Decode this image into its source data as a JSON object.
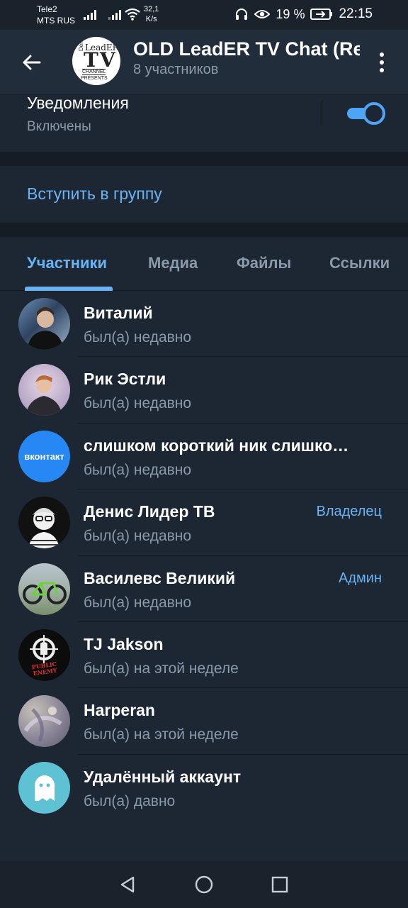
{
  "status_bar": {
    "carrier1": "Tele2",
    "carrier2": "MTS RUS",
    "speed_value": "32,1",
    "speed_unit": "K/s",
    "battery": "19 %",
    "time": "22:15"
  },
  "header": {
    "title": "OLD LeadER TV Chat (Re",
    "subtitle": "8 участников",
    "avatar_text": {
      "name": "LeadER",
      "tv": "TV",
      "channel": "CHANNEL",
      "presents": "PRESENTS",
      "denis": "Denis"
    }
  },
  "notifications": {
    "title": "Уведомления",
    "status": "Включены",
    "enabled": true
  },
  "join_button": "Вступить в группу",
  "tabs": [
    {
      "label": "Участники",
      "active": true
    },
    {
      "label": "Медиа",
      "active": false
    },
    {
      "label": "Файлы",
      "active": false
    },
    {
      "label": "Ссылки",
      "active": false
    }
  ],
  "members": [
    {
      "name": "Виталий",
      "status": "был(а) недавно",
      "role": ""
    },
    {
      "name": "Рик Эстли",
      "status": "был(а) недавно",
      "role": ""
    },
    {
      "name": "слишком короткий ник слишко…",
      "status": "был(а) недавно",
      "role": "",
      "avatar_text": "вконтакт"
    },
    {
      "name": "Денис Лидер ТВ",
      "status": "был(а) недавно",
      "role": "Владелец"
    },
    {
      "name": "Василевс Великий",
      "status": "был(а) недавно",
      "role": "Админ"
    },
    {
      "name": "TJ Jakson",
      "status": "был(а) на этой неделе",
      "role": "",
      "avatar_text": "PUBLIC ENEMY"
    },
    {
      "name": "Harperan",
      "status": "был(а) на этой неделе",
      "role": ""
    },
    {
      "name": "Удалённый аккаунт",
      "status": "был(а) давно",
      "role": ""
    }
  ],
  "colors": {
    "background": "#1d2733",
    "header": "#212d3b",
    "accent": "#6ab3f3",
    "secondary_text": "#8a9aab"
  }
}
